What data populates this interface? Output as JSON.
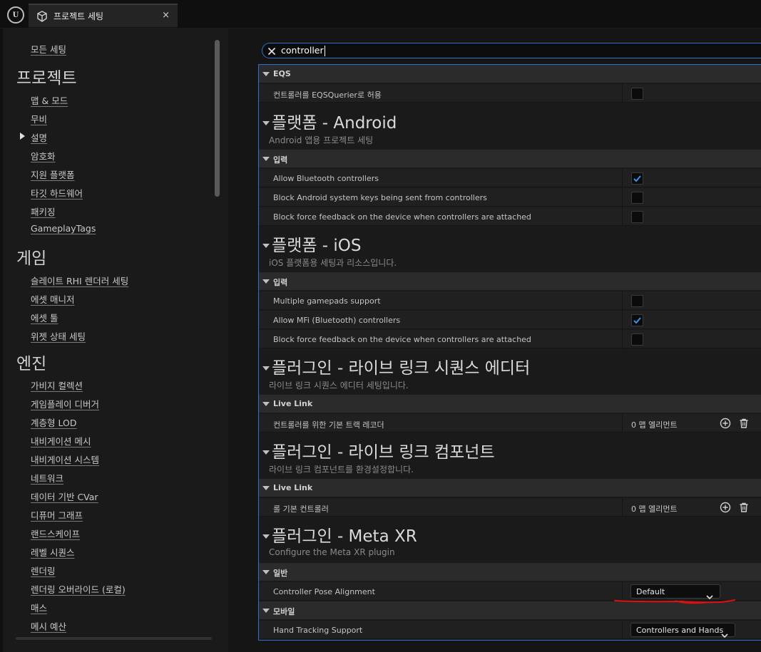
{
  "tab": {
    "title": "프로젝트 세팅",
    "close": "×"
  },
  "search": {
    "value": "controller"
  },
  "sidebar": {
    "all_settings": "모든 세팅",
    "groups": [
      {
        "heading": "프로젝트",
        "items": [
          "맵 & 모드",
          "무비",
          "설명",
          "암호화",
          "지원 플랫폼",
          "타깃 하드웨어",
          "패키징",
          "GameplayTags"
        ]
      },
      {
        "heading": "게임",
        "items": [
          "슬레이트 RHI 렌더러 세팅",
          "에셋 매니저",
          "에셋 툴",
          "위젯 상태 세팅"
        ]
      },
      {
        "heading": "엔진",
        "items": [
          "가비지 컬렉션",
          "게임플레이 디버거",
          "계층형 LOD",
          "내비게이션 메시",
          "내비게이션 시스템",
          "네트워크",
          "데이터 기반 CVar",
          "디퓨머 그래프",
          "랜드스케이프",
          "레벨 시퀀스",
          "렌더링",
          "렌더링 오버라이드 (로컬)",
          "매스",
          "메시 예산"
        ]
      }
    ]
  },
  "panel": {
    "eqs": {
      "category": "EQS",
      "rows": [
        {
          "label": "컨트롤러를 EQSQuerier로 허용",
          "checked": false
        }
      ]
    },
    "android": {
      "title": "플랫폼 - Android",
      "subtitle": "Android 앱용 프로젝트 세팅",
      "category": "입력",
      "rows": [
        {
          "label": "Allow Bluetooth controllers",
          "checked": true
        },
        {
          "label": "Block Android system keys being sent from controllers",
          "checked": false
        },
        {
          "label": "Block force feedback on the device when controllers are attached",
          "checked": false
        }
      ]
    },
    "ios": {
      "title": "플랫폼 - iOS",
      "subtitle": "iOS 플랫폼용 세팅과 리소스입니다.",
      "category": "입력",
      "rows": [
        {
          "label": "Multiple gamepads support",
          "checked": false
        },
        {
          "label": "Allow MFi (Bluetooth) controllers",
          "checked": true
        },
        {
          "label": "Block force feedback on the device when controllers are attached",
          "checked": false
        }
      ]
    },
    "ll_seq_editor": {
      "title": "플러그인 - 라이브 링크 시퀀스 에디터",
      "subtitle": "라이브 링크 시퀀스 에디터 세팅입니다.",
      "category": "Live Link",
      "row_label": "컨트롤러를 위한 기본 트랙 레코더",
      "row_value": "0 맵 엘리먼트"
    },
    "ll_component": {
      "title": "플러그인 - 라이브 링크 컴포넌트",
      "subtitle": "라이브 링크 컴포넌트를 환경설정합니다.",
      "category": "Live Link",
      "row_label": "롤 기본 컨트롤러",
      "row_value": "0 맵 엘리먼트"
    },
    "meta_xr": {
      "title": "플러그인 - Meta XR",
      "subtitle": "Configure the Meta XR plugin",
      "category_general": "일반",
      "pose_label": "Controller Pose Alignment",
      "pose_value": "Default",
      "category_mobile": "모바일",
      "hand_label": "Hand Tracking Support",
      "hand_value": "Controllers and Hands"
    }
  },
  "colors": {
    "accent": "#2f6fd0",
    "check": "#3b8ff0",
    "annotation": "#e01010"
  }
}
